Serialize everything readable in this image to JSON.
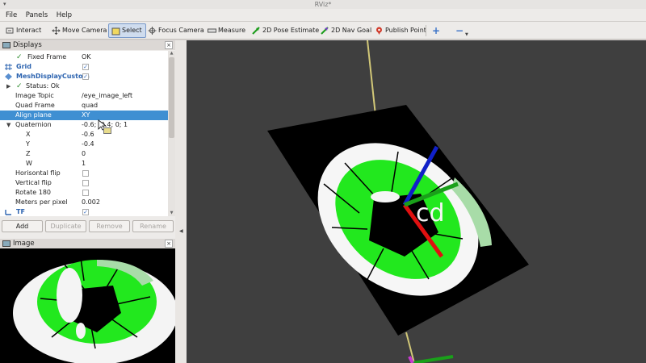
{
  "window": {
    "title": "RViz*"
  },
  "menu": [
    {
      "name": "file",
      "label": "File"
    },
    {
      "name": "panels",
      "label": "Panels"
    },
    {
      "name": "help",
      "label": "Help"
    }
  ],
  "toolbar": {
    "interact": "Interact",
    "move_camera": "Move Camera",
    "select": "Select",
    "focus_camera": "Focus Camera",
    "measure": "Measure",
    "pose_estimate": "2D Pose Estimate",
    "nav_goal": "2D Nav Goal",
    "publish_point": "Publish Point",
    "add_tool": "+",
    "remove_tool": "−"
  },
  "displays_panel": {
    "title": "Displays",
    "rows": [
      {
        "key": "Fixed Frame",
        "value": "OK"
      },
      {
        "key": "Grid",
        "value": ""
      },
      {
        "key": "MeshDisplayCustom",
        "value": ""
      },
      {
        "key": "Status: Ok",
        "value": ""
      },
      {
        "key": "Image Topic",
        "value": "/eye_image_left"
      },
      {
        "key": "Quad Frame",
        "value": "quad"
      },
      {
        "key": "Align plane",
        "value": "XY"
      },
      {
        "key": "Quaternion",
        "value": "-0.6; -0.4; 0; 1"
      },
      {
        "key": "X",
        "value": "-0.6"
      },
      {
        "key": "Y",
        "value": "-0.4"
      },
      {
        "key": "Z",
        "value": "0"
      },
      {
        "key": "W",
        "value": "1"
      },
      {
        "key": "Horisontal flip",
        "value": ""
      },
      {
        "key": "Vertical flip",
        "value": ""
      },
      {
        "key": "Rotate 180",
        "value": ""
      },
      {
        "key": "Meters per pixel",
        "value": "0.002"
      },
      {
        "key": "TF",
        "value": ""
      }
    ],
    "buttons": {
      "add": "Add",
      "duplicate": "Duplicate",
      "remove": "Remove",
      "rename": "Rename"
    }
  },
  "image_panel": {
    "title": "Image"
  },
  "scene": {
    "overlay_text": "cd"
  },
  "colors": {
    "selection": "#3f8fd2",
    "eye_green": "#22e81e",
    "viewport_bg": "#3f3f3f",
    "axis_x": "#e01010",
    "axis_y": "#1aa01a",
    "axis_z": "#1020c8"
  }
}
